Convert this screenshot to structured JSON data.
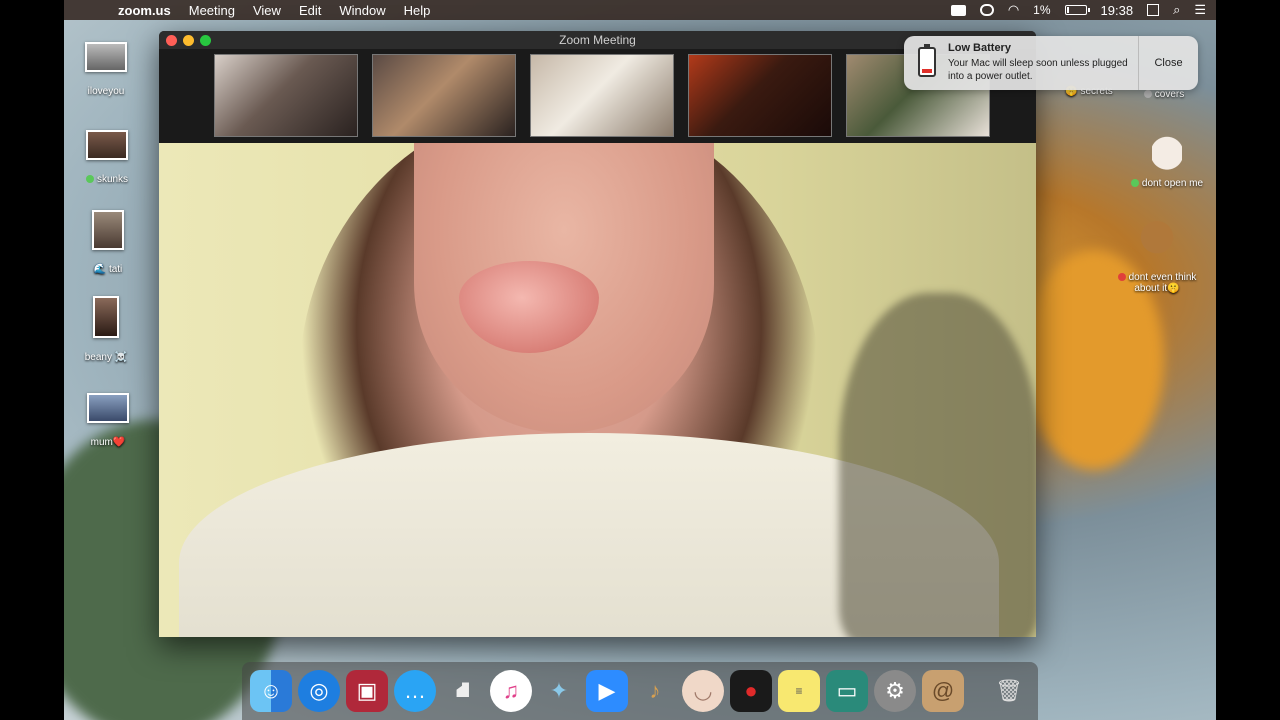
{
  "menubar": {
    "apple_glyph": "",
    "app_name": "zoom.us",
    "menus": [
      "Meeting",
      "View",
      "Edit",
      "Window",
      "Help"
    ],
    "battery_percent": "1%",
    "battery_level": 0.01,
    "time": "19:38"
  },
  "desktop_icons_left": [
    {
      "label": "iloveyou"
    },
    {
      "label": "skunks",
      "dot": "green"
    },
    {
      "label": "tati",
      "emoji": "🌊"
    },
    {
      "label": "beany",
      "emoji": "☠️"
    },
    {
      "label": "mum",
      "emoji": "❤️"
    }
  ],
  "desktop_icons_right": [
    {
      "label": "secrets",
      "emoji": "🤫"
    },
    {
      "label": "covers",
      "dot": "gray"
    },
    {
      "label": "dont open me",
      "dot": "green"
    },
    {
      "label": "dont even think about it",
      "emoji": "🤫",
      "dot": "red"
    }
  ],
  "zoom_window": {
    "title": "Zoom Meeting",
    "participants_count_visible": 5
  },
  "notification": {
    "title": "Low Battery",
    "message": "Your Mac will sleep soon unless plugged into a power outlet.",
    "close_label": "Close"
  },
  "dock": {
    "apps": [
      "finder",
      "safari",
      "photo-booth",
      "messages",
      "inkscape",
      "itunes",
      "sequel",
      "zoom",
      "garageband",
      "face",
      "voice-memos",
      "stickies",
      "preview",
      "system-preferences",
      "contacts",
      "trash"
    ]
  },
  "colors": {
    "menubar_bg": "#3a2e28",
    "tl_red": "#ff5f57",
    "tl_yellow": "#febc2e",
    "tl_green": "#28c840"
  }
}
